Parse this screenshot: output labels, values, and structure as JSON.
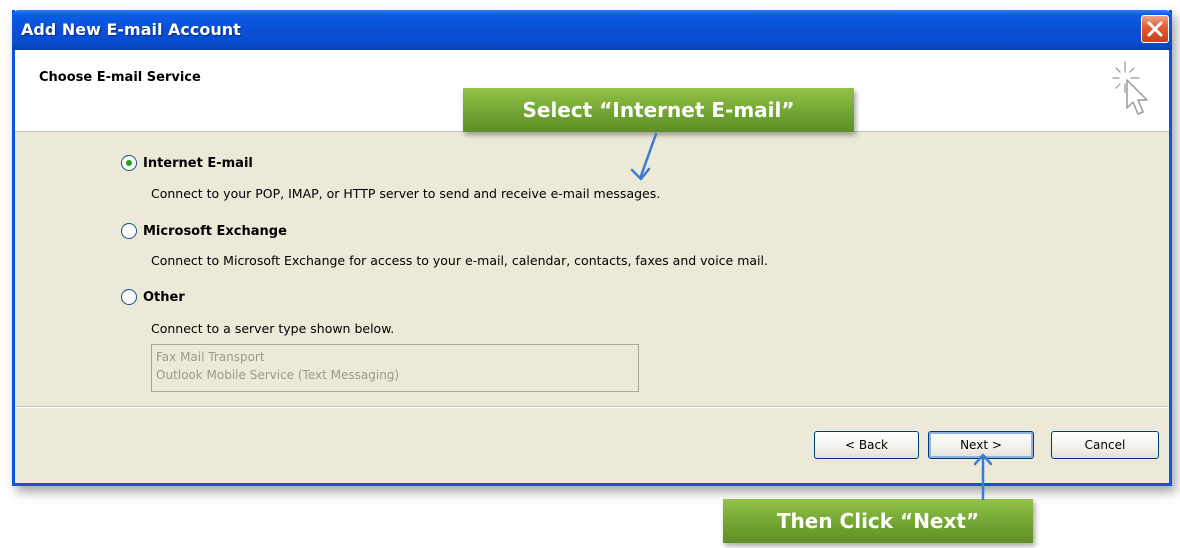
{
  "window": {
    "title": "Add New E-mail Account"
  },
  "header": {
    "title": "Choose E-mail Service"
  },
  "options": [
    {
      "label": "Internet E-mail",
      "description": "Connect to your POP, IMAP, or HTTP server to send and receive e-mail messages.",
      "selected": true
    },
    {
      "label": "Microsoft Exchange",
      "description": "Connect to Microsoft Exchange for access to your e-mail, calendar, contacts, faxes and voice mail.",
      "selected": false
    },
    {
      "label": "Other",
      "description": "Connect to a server type shown below.",
      "selected": false
    }
  ],
  "server_types": [
    "Fax Mail Transport",
    "Outlook Mobile Service (Text Messaging)"
  ],
  "buttons": {
    "back": "< Back",
    "next": "Next >",
    "cancel": "Cancel"
  },
  "annotations": {
    "select_callout": "Select “Internet E-mail”",
    "next_callout": "Then Click “Next”"
  },
  "colors": {
    "titlebar_blue": "#0a4fd6",
    "close_red": "#e25a2c",
    "dialog_bg": "#ece9d8",
    "callout_green": "#72a533",
    "annotation_arrow": "#3b7bd1"
  },
  "icons": {
    "close": "close-x-icon",
    "header": "sparkle-cursor-icon"
  }
}
